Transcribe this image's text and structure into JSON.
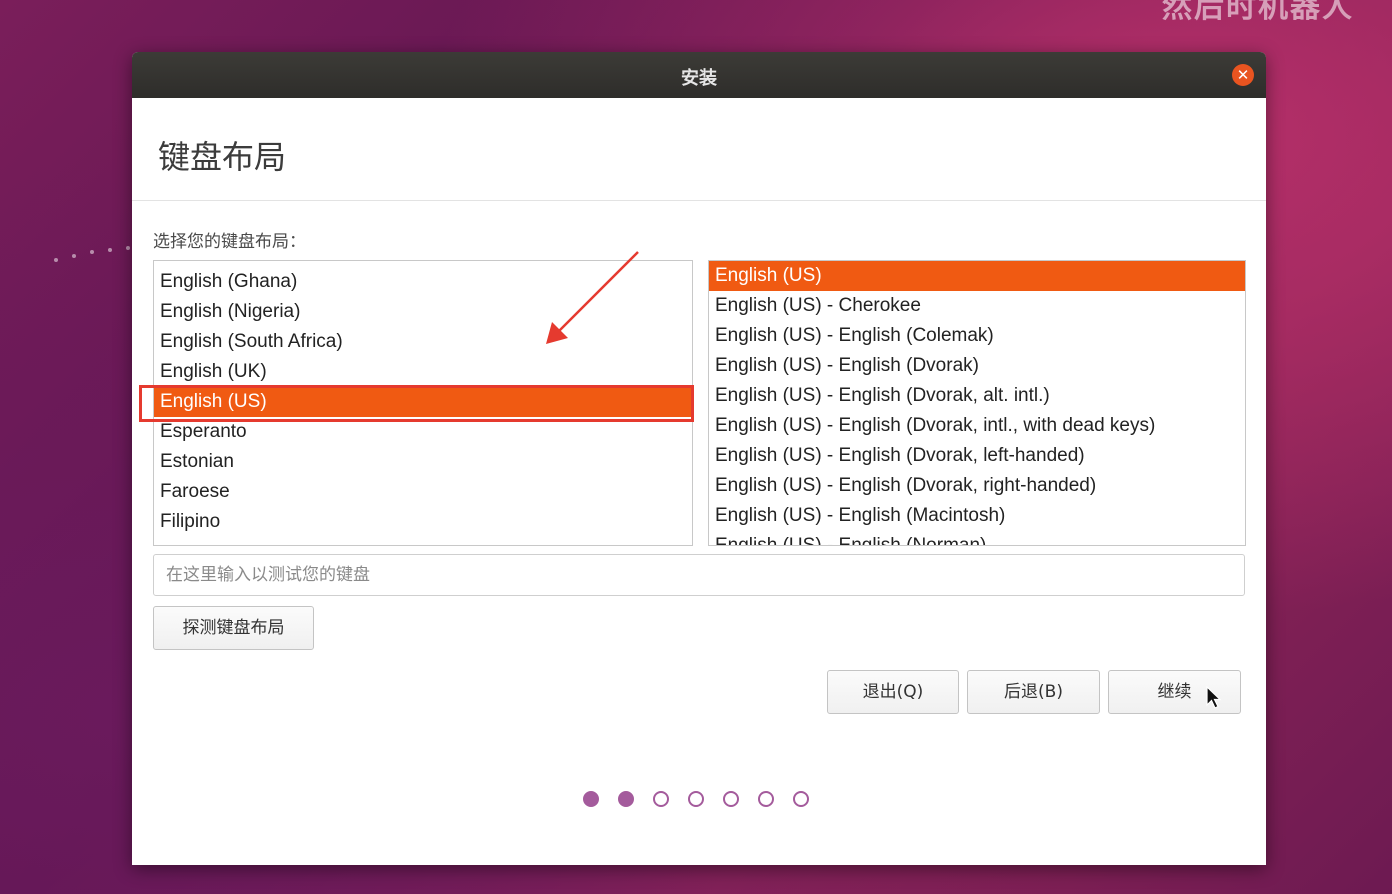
{
  "background": {
    "watermark_text": "然后时机器人"
  },
  "window": {
    "title": "安装",
    "close_icon": "close-icon"
  },
  "page": {
    "title": "键盘布局",
    "prompt": "选择您的键盘布局："
  },
  "layouts": {
    "items": [
      "English (Ghana)",
      "English (Nigeria)",
      "English (South Africa)",
      "English (UK)",
      "English (US)",
      "Esperanto",
      "Estonian",
      "Faroese",
      "Filipino"
    ],
    "selected": "English (US)"
  },
  "variants": {
    "items": [
      "English (US)",
      "English (US) - Cherokee",
      "English (US) - English (Colemak)",
      "English (US) - English (Dvorak)",
      "English (US) - English (Dvorak, alt. intl.)",
      "English (US) - English (Dvorak, intl., with dead keys)",
      "English (US) - English (Dvorak, left-handed)",
      "English (US) - English (Dvorak, right-handed)",
      "English (US) - English (Macintosh)",
      "English (US) - English (Norman)"
    ],
    "selected": "English (US)"
  },
  "test_input": {
    "placeholder": "在这里输入以测试您的键盘",
    "value": ""
  },
  "buttons": {
    "detect": "探测键盘布局",
    "quit": "退出(Q)",
    "back": "后退(B)",
    "continue": "继续"
  },
  "progress": {
    "total_steps": 7,
    "completed_steps": 2
  },
  "colors": {
    "accent": "#f05a12",
    "close_button": "#e95420",
    "annotation": "#e53a2f",
    "progress_dot": "#a45b9c"
  }
}
